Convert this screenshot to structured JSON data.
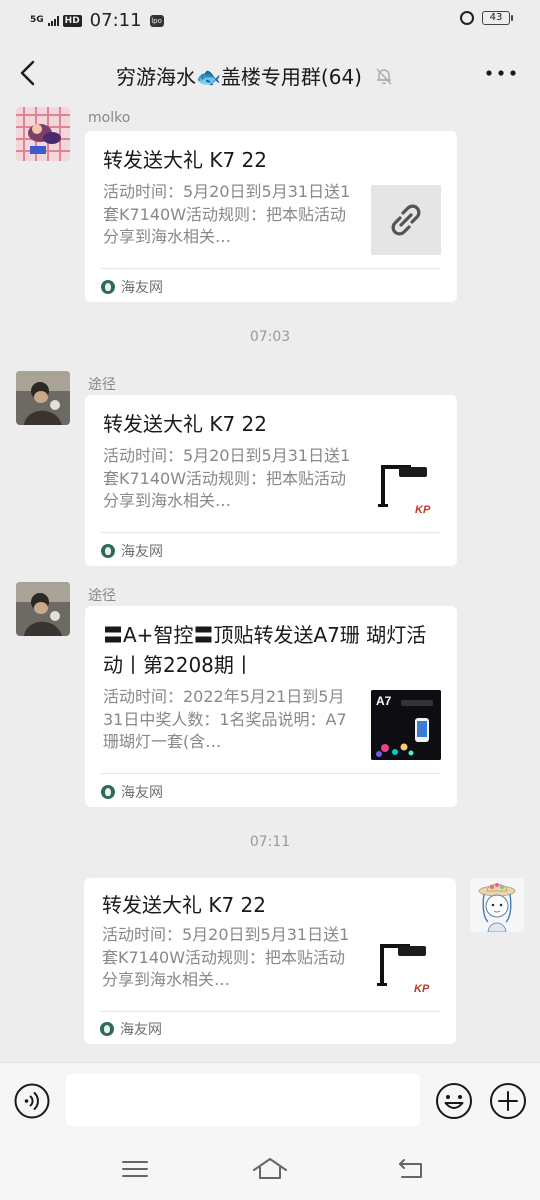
{
  "status_bar": {
    "signal": "5G",
    "hd": "HD",
    "time": "07:11",
    "app_badge": "lpo",
    "battery": "43"
  },
  "chat": {
    "title": "穷游海水🐟盖楼专用群(64)"
  },
  "messages": [
    {
      "sender": "molko",
      "card_title": "转发送大礼 K7 22",
      "card_desc": "活动时间：5月20日到5月31日送1套K7140W活动规则：把本贴活动分享到海水相关…",
      "thumb": "link-icon",
      "source": "海友网"
    },
    {
      "timestamp": "07:03"
    },
    {
      "sender": "途径",
      "card_title": "转发送大礼 K7 22",
      "card_desc": "活动时间：5月20日到5月31日送1套K7140W活动规则：把本贴活动分享到海水相关…",
      "thumb": "k7-lamp-image",
      "thumb_text": "KP",
      "source": "海友网"
    },
    {
      "sender": "途径",
      "card_title": "〓A+智控〓顶贴转发送A7珊 瑚灯活动丨第2208期丨",
      "card_desc": "活动时间：2022年5月21日到5月31日中奖人数：1名奖品说明：A7珊瑚灯一套(含…",
      "thumb": "a7-lamp-image",
      "thumb_text": "A7",
      "source": "海友网"
    },
    {
      "timestamp": "07:11"
    },
    {
      "sender": "",
      "self": true,
      "card_title": "转发送大礼 K7 22",
      "card_desc": "活动时间：5月20日到5月31日送1套K7140W活动规则：把本贴活动分享到海水相关…",
      "thumb": "k7-lamp-image",
      "thumb_text": "KP",
      "source": "海友网"
    }
  ],
  "input_bar": {
    "placeholder": ""
  },
  "colors": {
    "background": "#ededed",
    "card": "#ffffff",
    "muted_text": "#888888",
    "brand_red": "#c0392b"
  }
}
